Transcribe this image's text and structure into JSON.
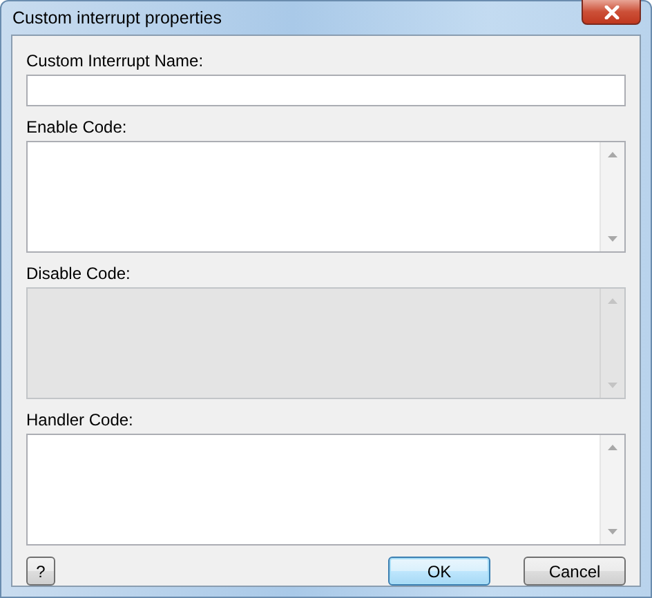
{
  "window": {
    "title": "Custom interrupt properties"
  },
  "name_field": {
    "label": "Custom Interrupt Name:"
  },
  "code_fields": [
    {
      "label": "Enable Code:",
      "disabled": false
    },
    {
      "label": "Disable Code:",
      "disabled": true
    },
    {
      "label": "Handler Code:",
      "disabled": false
    }
  ],
  "buttons": [
    {
      "label": "?",
      "kind": "help"
    },
    {
      "label": "OK",
      "kind": "default"
    },
    {
      "label": "Cancel",
      "kind": "normal"
    }
  ]
}
